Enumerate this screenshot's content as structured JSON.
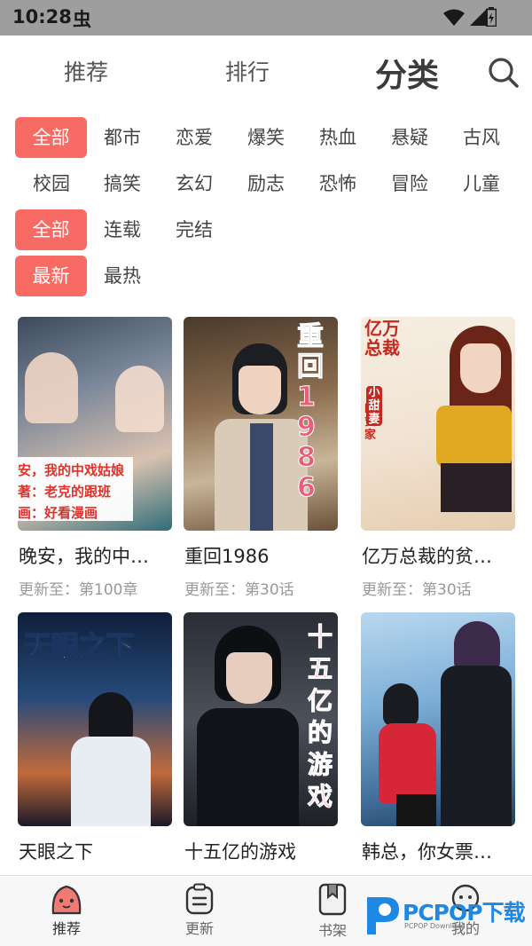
{
  "status_bar": {
    "time": "10:28",
    "bug_glyph": "虫"
  },
  "top_nav": {
    "tabs": [
      {
        "label": "推荐"
      },
      {
        "label": "排行"
      },
      {
        "label": "分类"
      }
    ],
    "active_tab": "分类",
    "search_icon": "search-icon"
  },
  "filters": {
    "genre": [
      "全部",
      "都市",
      "恋爱",
      "爆笑",
      "热血",
      "悬疑",
      "古风",
      "校园",
      "搞笑",
      "玄幻",
      "励志",
      "恐怖",
      "冒险",
      "儿童"
    ],
    "genre_selected": "全部",
    "status": [
      "全部",
      "连载",
      "完结"
    ],
    "status_selected": "全部",
    "sort": [
      "最新",
      "最热"
    ],
    "sort_selected": "最新"
  },
  "comics": [
    {
      "title": "晚安，我的中…",
      "update": "更新至：第100章",
      "cover_lines": [
        "安，我的中戏姑娘",
        "著：老克的跟班",
        "画：好看漫画"
      ]
    },
    {
      "title": "重回1986",
      "update": "更新至：第30话",
      "cover_lines": [
        "重回1986"
      ]
    },
    {
      "title": "亿万总裁的贫…",
      "update": "更新至：第30话",
      "cover_lines": [
        "亿万总裁",
        "的贫家",
        "小甜妻"
      ]
    },
    {
      "title": "天眼之下",
      "update": "",
      "cover_lines": [
        "天眼之下"
      ]
    },
    {
      "title": "十五亿的游戏",
      "update": "",
      "cover_lines": [
        "十五亿的游戏"
      ]
    },
    {
      "title": "韩总，你女票…",
      "update": "",
      "cover_lines": []
    }
  ],
  "bottom_tabs": [
    {
      "label": "推荐",
      "icon": "pet-face-icon"
    },
    {
      "label": "更新",
      "icon": "clipboard-icon"
    },
    {
      "label": "书架",
      "icon": "bookmark-book-icon"
    },
    {
      "label": "我的",
      "icon": "user-face-icon"
    }
  ],
  "active_bottom_tab": "推荐",
  "watermark": {
    "brand": "PCPOP下载",
    "sub": "PCPOP Download"
  },
  "colors": {
    "accent": "#f76b64",
    "status_bar": "#9e9e9e"
  }
}
